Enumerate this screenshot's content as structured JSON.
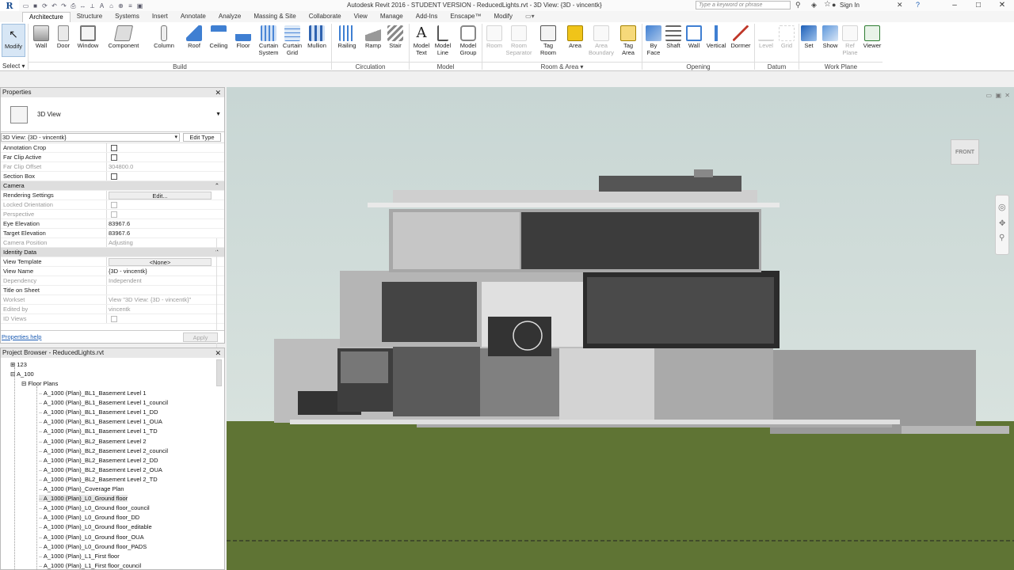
{
  "title_bar": {
    "title": "Autodesk Revit 2016 - STUDENT VERSION -    ReducedLights.rvt - 3D View: {3D - vincentk}",
    "search_placeholder": "Type a keyword or phrase",
    "sign_in": "Sign In"
  },
  "tabs": [
    "Architecture",
    "Structure",
    "Systems",
    "Insert",
    "Annotate",
    "Analyze",
    "Massing & Site",
    "Collaborate",
    "View",
    "Manage",
    "Add-Ins",
    "Enscape™",
    "Modify"
  ],
  "ribbon": {
    "modify": "Modify",
    "build": [
      "Wall",
      "Door",
      "Window",
      "Component",
      "Column",
      "Roof",
      "Ceiling",
      "Floor",
      "Curtain System",
      "Curtain Grid",
      "Mullion"
    ],
    "circulation": [
      "Railing",
      "Ramp",
      "Stair"
    ],
    "model": [
      "Model Text",
      "Model Line",
      "Model Group"
    ],
    "room_area": [
      "Room",
      "Room Separator",
      "Tag Room",
      "Area",
      "Area Boundary",
      "Tag Area"
    ],
    "opening": [
      "By Face",
      "Shaft",
      "Wall",
      "Vertical",
      "Dormer"
    ],
    "datum": [
      "Level",
      "Grid"
    ],
    "work_plane": [
      "Set",
      "Show",
      "Ref Plane",
      "Viewer"
    ],
    "panels": {
      "select": "Select",
      "build": "Build",
      "circulation": "Circulation",
      "model": "Model",
      "room_area": "Room & Area",
      "opening": "Opening",
      "datum": "Datum",
      "work_plane": "Work Plane"
    }
  },
  "properties": {
    "header": "Properties",
    "type_name": "3D View",
    "instance_selector": "3D View: {3D - vincentk}",
    "edit_type": "Edit Type",
    "rows": [
      {
        "k": "Annotation Crop",
        "type": "check",
        "dim": false
      },
      {
        "k": "Far Clip Active",
        "type": "check",
        "dim": false
      },
      {
        "k": "Far Clip Offset",
        "v": "304800.0",
        "dim": true
      },
      {
        "k": "Section Box",
        "type": "check",
        "dim": false
      },
      {
        "k": "Camera",
        "group": true
      },
      {
        "k": "Rendering Settings",
        "v": "Edit...",
        "type": "button"
      },
      {
        "k": "Locked Orientation",
        "type": "check",
        "dim": true
      },
      {
        "k": "Perspective",
        "type": "check",
        "dim": true
      },
      {
        "k": "Eye Elevation",
        "v": "83967.6"
      },
      {
        "k": "Target Elevation",
        "v": "83967.6"
      },
      {
        "k": "Camera Position",
        "v": "Adjusting",
        "dim": true
      },
      {
        "k": "Identity Data",
        "group": true
      },
      {
        "k": "View Template",
        "v": "<None>",
        "type": "button"
      },
      {
        "k": "View Name",
        "v": "{3D - vincentk}"
      },
      {
        "k": "Dependency",
        "v": "Independent",
        "dim": true
      },
      {
        "k": "Title on Sheet",
        "v": ""
      },
      {
        "k": "Workset",
        "v": "View \"3D View: {3D - vincentk}\"",
        "dim": true
      },
      {
        "k": "Edited by",
        "v": "vincentk",
        "dim": true
      },
      {
        "k": "ID Views",
        "type": "check",
        "dim": true
      }
    ],
    "help": "Properties help",
    "apply": "Apply"
  },
  "browser": {
    "header": "Project Browser - ReducedLights.rvt",
    "nodes": [
      "123",
      "A_100",
      "Floor Plans"
    ],
    "items": [
      "A_1000 (Plan)_BL1_Basement Level 1",
      "A_1000 (Plan)_BL1_Basement Level 1_council",
      "A_1000 (Plan)_BL1_Basement Level 1_DD",
      "A_1000 (Plan)_BL1_Basement Level 1_OUA",
      "A_1000 (Plan)_BL1_Basement Level 1_TD",
      "A_1000 (Plan)_BL2_Basement Level 2",
      "A_1000 (Plan)_BL2_Basement Level 2_council",
      "A_1000 (Plan)_BL2_Basement Level 2_DD",
      "A_1000 (Plan)_BL2_Basement Level 2_OUA",
      "A_1000 (Plan)_BL2_Basement Level 2_TD",
      "A_1000 (Plan)_Coverage Plan",
      "A_1000 (Plan)_L0_Ground floor",
      "A_1000 (Plan)_L0_Ground floor_council",
      "A_1000 (Plan)_L0_Ground floor_DD",
      "A_1000 (Plan)_L0_Ground floor_editable",
      "A_1000 (Plan)_L0_Ground floor_OUA",
      "A_1000 (Plan)_L0_Ground floor_PADS",
      "A_1000 (Plan)_L1_First floor",
      "A_1000 (Plan)_L1_First floor_council"
    ],
    "selected_index": 11
  },
  "viewport": {
    "viewcube_face": "FRONT",
    "sky_color": "#bfcfd0",
    "ground_color": "#5e7233"
  }
}
